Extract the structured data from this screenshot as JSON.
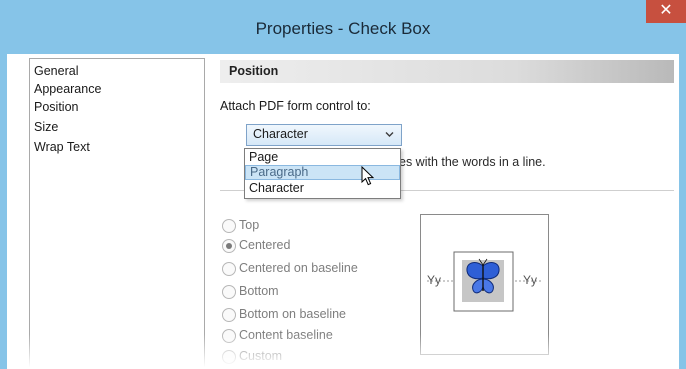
{
  "window": {
    "title": "Properties - Check Box",
    "close_glyph": "✕"
  },
  "sidebar": {
    "items": [
      {
        "label": "General"
      },
      {
        "label": "Appearance"
      },
      {
        "label": "Position"
      },
      {
        "label": "Size"
      },
      {
        "label": "Wrap Text"
      }
    ]
  },
  "section": {
    "title": "Position"
  },
  "attach": {
    "label": "Attach PDF form control to:",
    "selected": "Character",
    "options": [
      "Page",
      "Paragraph",
      "Character"
    ],
    "highlighted": "Paragraph"
  },
  "hint": {
    "visible_text": "es with the words in a line."
  },
  "alignment": {
    "options": [
      {
        "label": "Top",
        "checked": false
      },
      {
        "label": "Centered",
        "checked": true
      },
      {
        "label": "Centered on baseline",
        "checked": false
      },
      {
        "label": "Bottom",
        "checked": false
      },
      {
        "label": "Bottom on baseline",
        "checked": false
      },
      {
        "label": "Content baseline",
        "checked": false
      },
      {
        "label": "Custom",
        "checked": false
      }
    ]
  },
  "preview": {
    "left_text": "Yy",
    "right_text": "Yy",
    "icon": "butterfly-icon"
  },
  "colors": {
    "titlebar": "#86c4e8",
    "close": "#c7503f",
    "selection": "#cbe4f6"
  }
}
